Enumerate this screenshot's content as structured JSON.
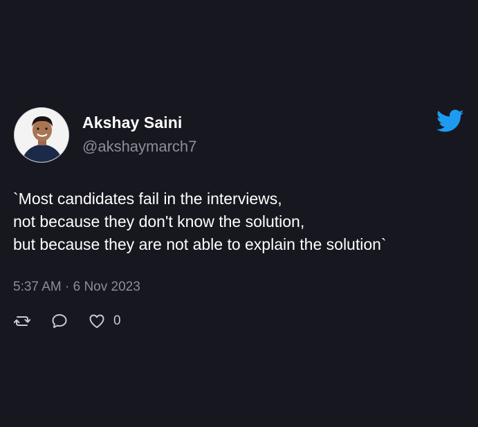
{
  "author": {
    "name": "Akshay Saini",
    "handle": "@akshaymarch7"
  },
  "tweet": {
    "line1": "`Most candidates fail in the interviews,",
    "line2": "not because they don't know the solution,",
    "line3": "but because they are not able to explain the solution`",
    "timestamp": "5:37 AM · 6 Nov 2023"
  },
  "actions": {
    "like_count": "0"
  },
  "icons": {
    "brand": "twitter-bird-icon",
    "retweet": "retweet-icon",
    "reply": "reply-icon",
    "like": "heart-icon"
  },
  "colors": {
    "background": "#17171f",
    "brand": "#1d9bf0",
    "muted_text": "#8b8f98"
  }
}
